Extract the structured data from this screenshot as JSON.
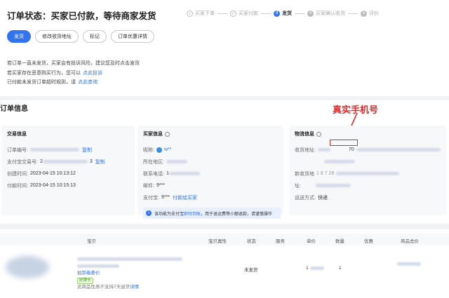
{
  "header": {
    "status_title": "订单状态：买家已付款，等待商家发货",
    "steps": [
      {
        "label": "买家下单",
        "state": "done"
      },
      {
        "label": "买家付款",
        "state": "done"
      },
      {
        "number": "3",
        "label": "发货",
        "state": "active"
      },
      {
        "number": "4",
        "label": "买家确认收货",
        "state": "todo"
      },
      {
        "number": "5",
        "label": "评价",
        "state": "todo"
      }
    ],
    "check_icon": "✓"
  },
  "actions": {
    "ship": "发货",
    "edit_address": "修改收货地址",
    "mark": "标记",
    "discount_detail": "订单优惠详情"
  },
  "notices": [
    {
      "text": "若订单一直未发货，买家会有投诉风险，建议您及时点击发货",
      "link": ""
    },
    {
      "text": "若买家存在恶意购买行为，您可以",
      "link": "点此投诉"
    },
    {
      "text": "已付款未发货订单超时规则，请",
      "link": "点此查询"
    }
  ],
  "order_info": {
    "title": "订单信息",
    "annotation": "真实手机号",
    "trade": {
      "title": "交易信息",
      "order_no_label": "订单编号:",
      "order_no_value": "",
      "copy": "复制",
      "alipay_label": "支付宝交易号:",
      "alipay_value": "2",
      "alipay_suffix": "3",
      "created_label": "创建时间:",
      "created_value": "2023-04-15 10:13:12",
      "paid_label": "付款时间:",
      "paid_value": "2023-04-15 10:15:13"
    },
    "buyer": {
      "title": "买家信息",
      "nick_label": "昵称:",
      "nick_value": "w**",
      "region_label": "所在地区:",
      "phone_label": "联系电话:",
      "phone_value": "1",
      "email_label": "邮件:",
      "email_value": "9***",
      "alipay_label": "支付宝:",
      "alipay_value": "9***",
      "contact_link": "付款给买家",
      "tip_icon": "i",
      "tip_prefix": "该功能为支付宝",
      "tip_link": "即时到账",
      "tip_suffix": "，用于退运费等小额退款，请谨慎操作"
    },
    "logistics": {
      "title": "物流信息",
      "address_label": "收货地址:",
      "address_mid": "70",
      "new_address_label": "新收货地",
      "new_address_frag": "1  8     7  28",
      "address_cont": "址:",
      "shipping_label": "运送方式:",
      "shipping_value": "快递"
    }
  },
  "goods": {
    "columns": [
      "宝贝",
      "宝贝属性",
      "状态",
      "服务",
      "单价",
      "数量",
      "优惠",
      "商品总价"
    ],
    "item": {
      "tag1": "拍卸着委价",
      "tag2": "好牌卡",
      "note": "此商品性质不支持7天退货",
      "note_link": "详情",
      "status": "未发货",
      "unit_price": "1",
      "quantity": "1"
    }
  }
}
